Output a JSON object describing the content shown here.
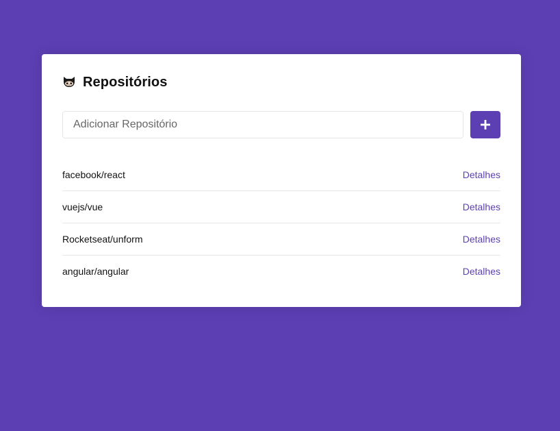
{
  "colors": {
    "background": "#5c3fb3",
    "accent": "#5c3fb3",
    "card": "#ffffff"
  },
  "header": {
    "icon": "github-icon",
    "title": "Repositórios"
  },
  "form": {
    "placeholder": "Adicionar Repositório",
    "value": "",
    "add_button_icon": "plus-icon"
  },
  "repositories": [
    {
      "name": "facebook/react",
      "link_label": "Detalhes"
    },
    {
      "name": "vuejs/vue",
      "link_label": "Detalhes"
    },
    {
      "name": "Rocketseat/unform",
      "link_label": "Detalhes"
    },
    {
      "name": "angular/angular",
      "link_label": "Detalhes"
    }
  ]
}
